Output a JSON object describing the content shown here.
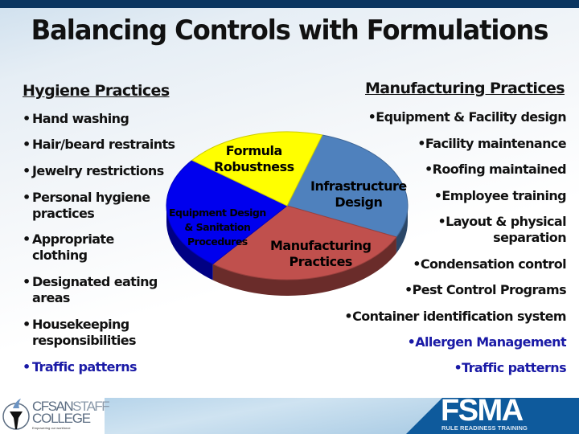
{
  "title": "Balancing Controls with Formulations",
  "left_section": {
    "heading": "Hygiene Practices",
    "items": [
      {
        "text": "Hand washing"
      },
      {
        "text": "Hair/beard restraints"
      },
      {
        "text": "Jewelry restrictions"
      },
      {
        "line1": "Personal hygiene",
        "line2": "practices"
      },
      {
        "line1": "Appropriate",
        "line2": "clothing"
      },
      {
        "line1": "Designated eating",
        "line2": "areas"
      },
      {
        "line1": "Housekeeping",
        "line2": "responsibilities"
      },
      {
        "text": "Traffic patterns",
        "highlight": true
      }
    ]
  },
  "right_section": {
    "heading": "Manufacturing Practices",
    "items": [
      {
        "text": "Equipment & Facility design"
      },
      {
        "text": "Facility maintenance"
      },
      {
        "text": "Roofing maintained"
      },
      {
        "text": "Employee training"
      },
      {
        "line1": "Layout & physical",
        "line2": "separation"
      },
      {
        "text": "Condensation control"
      },
      {
        "text": "Pest Control Programs"
      },
      {
        "text": "Container identification system"
      },
      {
        "text": "Allergen Management",
        "highlight": true
      },
      {
        "text": "Traffic patterns",
        "highlight": true
      }
    ]
  },
  "chart_data": {
    "type": "pie",
    "style": "3d",
    "title": "",
    "slices": [
      {
        "label": "Formula Robustness",
        "lines": [
          "Formula",
          "Robustness"
        ],
        "share_pct": 25,
        "color": "#ffff00",
        "text_color": "#1f3a68"
      },
      {
        "label": "Infrastructure Design",
        "lines": [
          "Infrastructure",
          "Design"
        ],
        "share_pct": 25,
        "color": "#4f81bd",
        "text_color": "#111111"
      },
      {
        "label": "Manufacturing Practices",
        "lines": [
          "Manufacturing",
          "Practices"
        ],
        "share_pct": 25,
        "color": "#c0504d",
        "text_color": "#111111"
      },
      {
        "label": "Equipment Design & Sanitation Procedures",
        "lines": [
          "Equipment Design",
          "& Sanitation",
          "Procedures"
        ],
        "share_pct": 25,
        "color": "#0000ee",
        "text_color": "#ffffff"
      }
    ]
  },
  "footer": {
    "left_logo": {
      "line1a": "CFSAN",
      "line1b": "STAFF",
      "line2": "COLLEGE",
      "tagline": "Empowering our workforce"
    },
    "right_logo": {
      "big": "FSMA",
      "small": "RULE READINESS TRAINING"
    },
    "colors": {
      "fsma_blue": "#0e5a9c",
      "top_bar": "#0a3560"
    }
  }
}
